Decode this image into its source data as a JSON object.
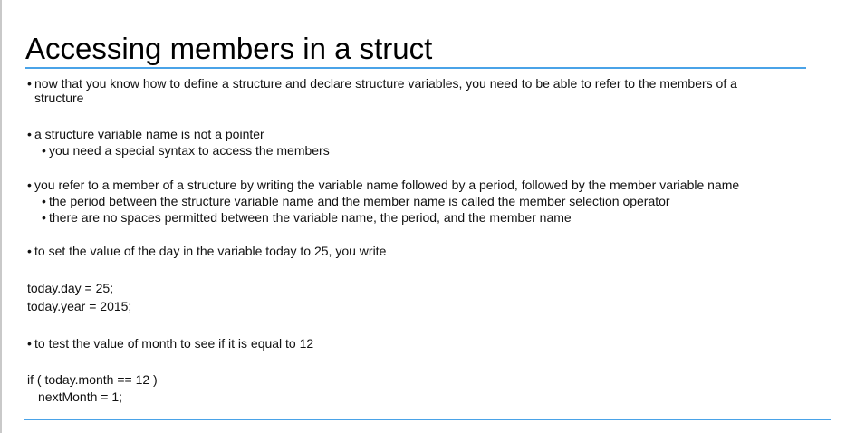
{
  "slide": {
    "title": "Accessing members in a struct",
    "accent_color": "#4aa3e8",
    "lines": {
      "p1": "now that you know how to define a structure and declare structure variables, you need to be able to refer to the members of a",
      "p1_cont": "structure",
      "p2": "a structure variable name is not a pointer",
      "p2_sub1": "you need a special syntax to access the members",
      "p3": "you refer to a member of a structure by writing the variable name followed by a period, followed by the member variable name",
      "p3_sub1": "the period between the structure variable name and the member name is called the member selection operator",
      "p3_sub2": "there are no spaces permitted between the variable name, the period, and the member name",
      "p4": "to set the value of the day in the variable today to 25, you write",
      "code1": "today.day = 25;",
      "code2": "today.year = 2015;",
      "p5": "to test the value of month to see if it is equal to 12",
      "code3": "if  ( today.month == 12 )",
      "code4": "nextMonth = 1;"
    },
    "bullet_glyph": "•"
  }
}
